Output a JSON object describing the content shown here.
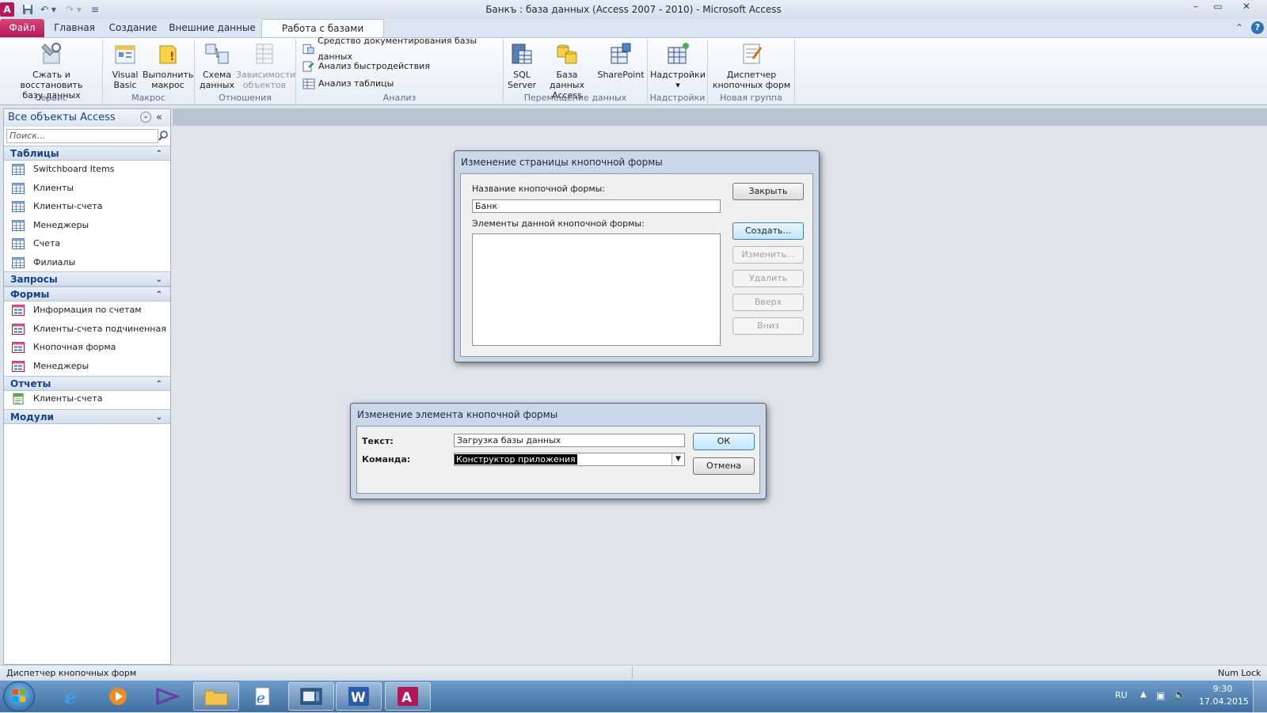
{
  "window": {
    "title": "Банкъ : база данных (Access 2007 - 2010)  -  Microsoft Access",
    "app_icon": "A",
    "minimize": "–",
    "restore": "▭",
    "close": "✕"
  },
  "ribbon_tabs": [
    "Файл",
    "Главная",
    "Создание",
    "Внешние данные",
    "Работа с базами данных"
  ],
  "ribbon": {
    "groups": {
      "service": "Сервис",
      "macro": "Макрос",
      "relations": "Отношения",
      "analysis": "Анализ",
      "move_data": "Перемещение данных",
      "addins": "Надстройки",
      "new_group": "Новая группа"
    },
    "compact_line1": "Сжать и восстановить",
    "compact_line2": "базу данных",
    "vb_line1": "Visual",
    "vb_line2": "Basic",
    "run_macro_line1": "Выполнить",
    "run_macro_line2": "макрос",
    "schema_line1": "Схема",
    "schema_line2": "данных",
    "deps_line1": "Зависимости",
    "deps_line2": "объектов",
    "documenter": "Средство документирования базы данных",
    "perf_analysis": "Анализ быстродействия",
    "table_analysis": "Анализ таблицы",
    "sql_line1": "SQL",
    "sql_line2": "Server",
    "access_db_line1": "База данных",
    "access_db_line2": "Access",
    "sharepoint": "SharePoint",
    "addins": "Надстройки",
    "addins_arrow": "▾",
    "switchboard_line1": "Диспетчер",
    "switchboard_line2": "кнопочных форм"
  },
  "nav": {
    "header": "Все объекты Access",
    "search_placeholder": "Поиск...",
    "collapse_icon": "«",
    "dropdown_icon": "⌄",
    "sections": {
      "tables": "Таблицы",
      "queries": "Запросы",
      "forms": "Формы",
      "reports": "Отчеты",
      "modules": "Модули"
    },
    "tables": [
      "Switchboard Items",
      "Клиенты",
      "Клиенты-счета",
      "Менеджеры",
      "Счета",
      "Филиалы"
    ],
    "forms": [
      "Информация по счетам",
      "Клиенты-счета подчиненная ...",
      "Кнопочная форма",
      "Менеджеры"
    ],
    "reports": [
      "Клиенты-счета"
    ]
  },
  "dialog_page": {
    "title": "Изменение страницы кнопочной формы",
    "name_label": "Название кнопочной формы:",
    "name_value": "Банк",
    "items_label": "Элементы данной кнопочной формы:",
    "close_btn": "Закрыть",
    "create_btn": "Создать...",
    "edit_btn": "Изменить...",
    "delete_btn": "Удалить",
    "up_btn": "Вверх",
    "down_btn": "Вниз"
  },
  "dialog_item": {
    "title": "Изменение элемента кнопочной формы",
    "text_label": "Текст:",
    "text_value": "Загрузка базы данных",
    "command_label": "Команда:",
    "command_value": "Конструктор приложения",
    "ok_btn": "ОК",
    "cancel_btn": "Отмена"
  },
  "status": {
    "left": "Диспетчер кнопочных форм",
    "right": "Num Lock"
  },
  "taskbar": {
    "lang": "RU",
    "time": "9:30",
    "date": "17.04.2015"
  },
  "colors": {
    "file_tab": "#c4175f",
    "accent": "#15428b",
    "taskbar": "#4f7fb0"
  }
}
